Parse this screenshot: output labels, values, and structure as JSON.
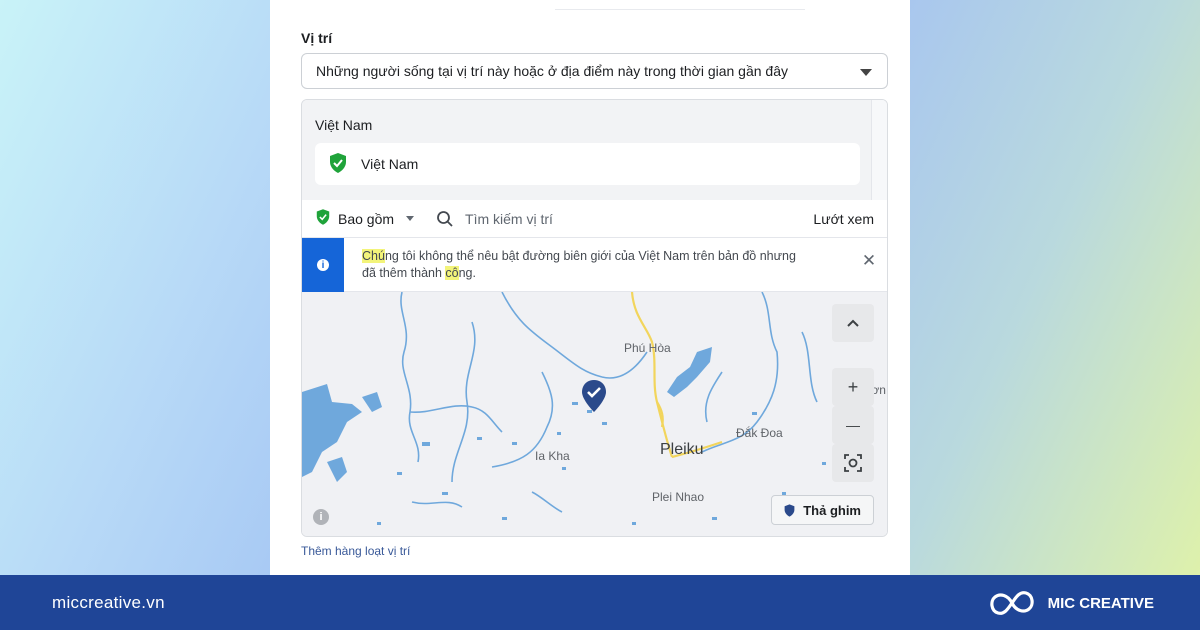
{
  "location": {
    "section_label": "Vị trí",
    "audience_select": "Những người sống tại vị trí này hoặc ở địa điểm này trong thời gian gần đây",
    "group_title": "Việt Nam",
    "selected_chip": "Việt Nam",
    "include_label": "Bao gồm",
    "search_placeholder": "Tìm kiếm vị trí",
    "browse_label": "Lướt xem",
    "notice": {
      "hl1": "Chú",
      "part1": "ng tôi không thể nêu bật đường biên giới của Việt Nam trên bản đồ nhưng",
      "part2": "đã thêm thành ",
      "hl2": "cô",
      "part3": "ng."
    },
    "bulk_link": "Thêm hàng loạt vị trí"
  },
  "map": {
    "labels": {
      "phu_hoa": "Phú Hòa",
      "kon_dong": "Kon Dơn",
      "dak_doa": "Đắk Đoa",
      "ia_kha": "Ia Kha",
      "pleiku": "Pleiku",
      "plei_nhao": "Plei Nhao"
    },
    "controls": {
      "zoom_in": "+",
      "zoom_out": "—"
    },
    "drop_pin_label": "Thả ghim",
    "water_color": "#6fa8dc",
    "road_color": "#f2d55c",
    "pin_color": "#2b4a8b"
  },
  "footer": {
    "site": "miccreative.vn",
    "brand": "MIC CREATIVE"
  },
  "colors": {
    "accent": "#1565d8",
    "footer_bg": "#1f4597",
    "include_green": "#1fa33a"
  }
}
